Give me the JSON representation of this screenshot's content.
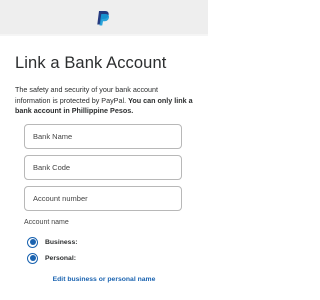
{
  "brand": {
    "logo_icon": "paypal-logo-icon",
    "color": "#1a63b0"
  },
  "page": {
    "title": "Link a Bank Account"
  },
  "description": {
    "plain": "The safety and security of your bank account information is protected by PayPal. ",
    "bold": "You can only link a bank account in Phillippine Pesos."
  },
  "form": {
    "bank_name": {
      "placeholder": "Bank Name",
      "value": ""
    },
    "bank_code": {
      "placeholder": "Bank Code",
      "value": ""
    },
    "account_number": {
      "placeholder": "Account number",
      "value": ""
    }
  },
  "account_name": {
    "label": "Account name",
    "options": [
      {
        "label": "Business:",
        "selected": true
      },
      {
        "label": "Personal:",
        "selected": true
      }
    ]
  },
  "edit_link": {
    "label": "Edit business or personal name"
  }
}
